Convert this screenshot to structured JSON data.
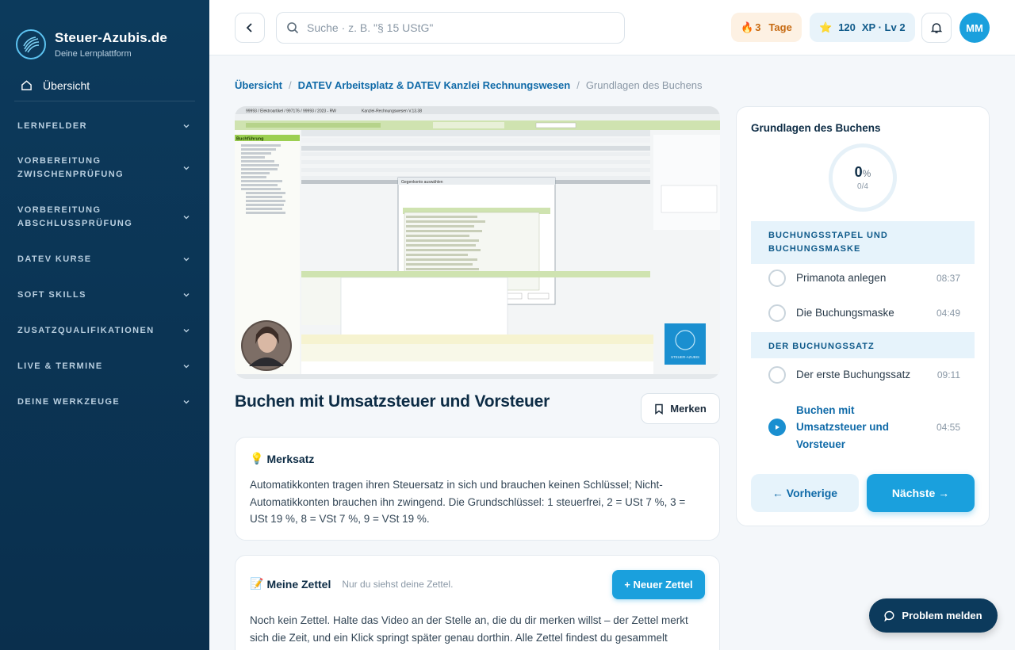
{
  "brand": {
    "title": "Steuer-Azubis.de",
    "subtitle": "Deine Lernplattform"
  },
  "sidebar": {
    "overview": "Übersicht",
    "sections": [
      {
        "lines": [
          "LERNFELDER"
        ]
      },
      {
        "lines": [
          "VORBEREITUNG",
          "ZWISCHENPRÜFUNG"
        ]
      },
      {
        "lines": [
          "VORBEREITUNG",
          "ABSCHLUSSPRÜFUNG"
        ]
      },
      {
        "lines": [
          "DATEV KURSE"
        ]
      },
      {
        "lines": [
          "SOFT SKILLS"
        ]
      },
      {
        "lines": [
          "ZUSATZQUALIFIKATIONEN"
        ]
      },
      {
        "lines": [
          "LIVE & TERMINE"
        ]
      },
      {
        "lines": [
          "DEINE WERKZEUGE"
        ]
      }
    ]
  },
  "topbar": {
    "search_placeholder": "Suche · z. B. \"§ 15 UStG\"",
    "streak_icon": "🔥",
    "streak_count": "3",
    "streak_label": "Tage",
    "xp_icon": "⭐",
    "xp_value": "120",
    "xp_label": "XP · Lv 2",
    "avatar_initials": "MM"
  },
  "breadcrumb": {
    "items": [
      "Übersicht",
      "DATEV Arbeitsplatz & DATEV Kanzlei Rechnungswesen"
    ],
    "current": "Grundlagen des Buchens",
    "separator": "/"
  },
  "lesson": {
    "title": "Buchen mit Umsatzsteuer und Vorsteuer",
    "bookmark_label": "Merken"
  },
  "merksatz": {
    "icon": "💡",
    "heading": "Merksatz",
    "text": "Automatikkonten tragen ihren Steuersatz in sich und brauchen keinen Schlüssel; Nicht-Automatikkonten brauchen ihn zwingend. Die Grundschlüssel: 1 steuerfrei, 2 = USt 7 %, 3 = USt 19 %, 8 = VSt 7 %, 9 = VSt 19 %."
  },
  "notes": {
    "icon": "📝",
    "heading": "Meine Zettel",
    "subtitle": "Nur du siehst deine Zettel.",
    "new_button": "+ Neuer Zettel",
    "empty_text": "Noch kein Zettel. Halte das Video an der Stelle an, die du dir merken willst – der Zettel merkt sich die Zeit, und ein Klick springt später genau dorthin. Alle Zettel findest du gesammelt"
  },
  "panel": {
    "title": "Grundlagen des Buchens",
    "progress_percent": "0",
    "progress_unit": "%",
    "progress_count": "0/4",
    "sections": [
      {
        "title": "BUCHUNGSSTAPEL UND BUCHUNGSMASKE",
        "lessons": [
          {
            "name": "Primanota anlegen",
            "duration": "08:37"
          },
          {
            "name": "Die Buchungsmaske",
            "duration": "04:49"
          }
        ]
      },
      {
        "title": "DER BUCHUNGSSATZ",
        "lessons": [
          {
            "name": "Der erste Buchungssatz",
            "duration": "09:11"
          },
          {
            "name": "Buchen mit Umsatzsteuer und Vorsteuer",
            "duration": "04:55"
          }
        ]
      }
    ],
    "prev_label": "← Vorherige",
    "next_label": "Nächste →"
  },
  "video": {
    "window_title": "99993 / Elektroartikel / 997176 / 99993 / 2023 - RW",
    "app_title": "Kanzlei-Rechnungswesen V.13.38",
    "sidebar_heading": "Buchführung",
    "dialog_title": "Gegenkonto auswählen",
    "watermark": "STEUER-AZUBIS"
  },
  "colors": {
    "accent": "#1aa0dd",
    "sidebar": "#0c3a5c",
    "active": "#0f6aa8"
  },
  "problem_button": "Problem melden"
}
